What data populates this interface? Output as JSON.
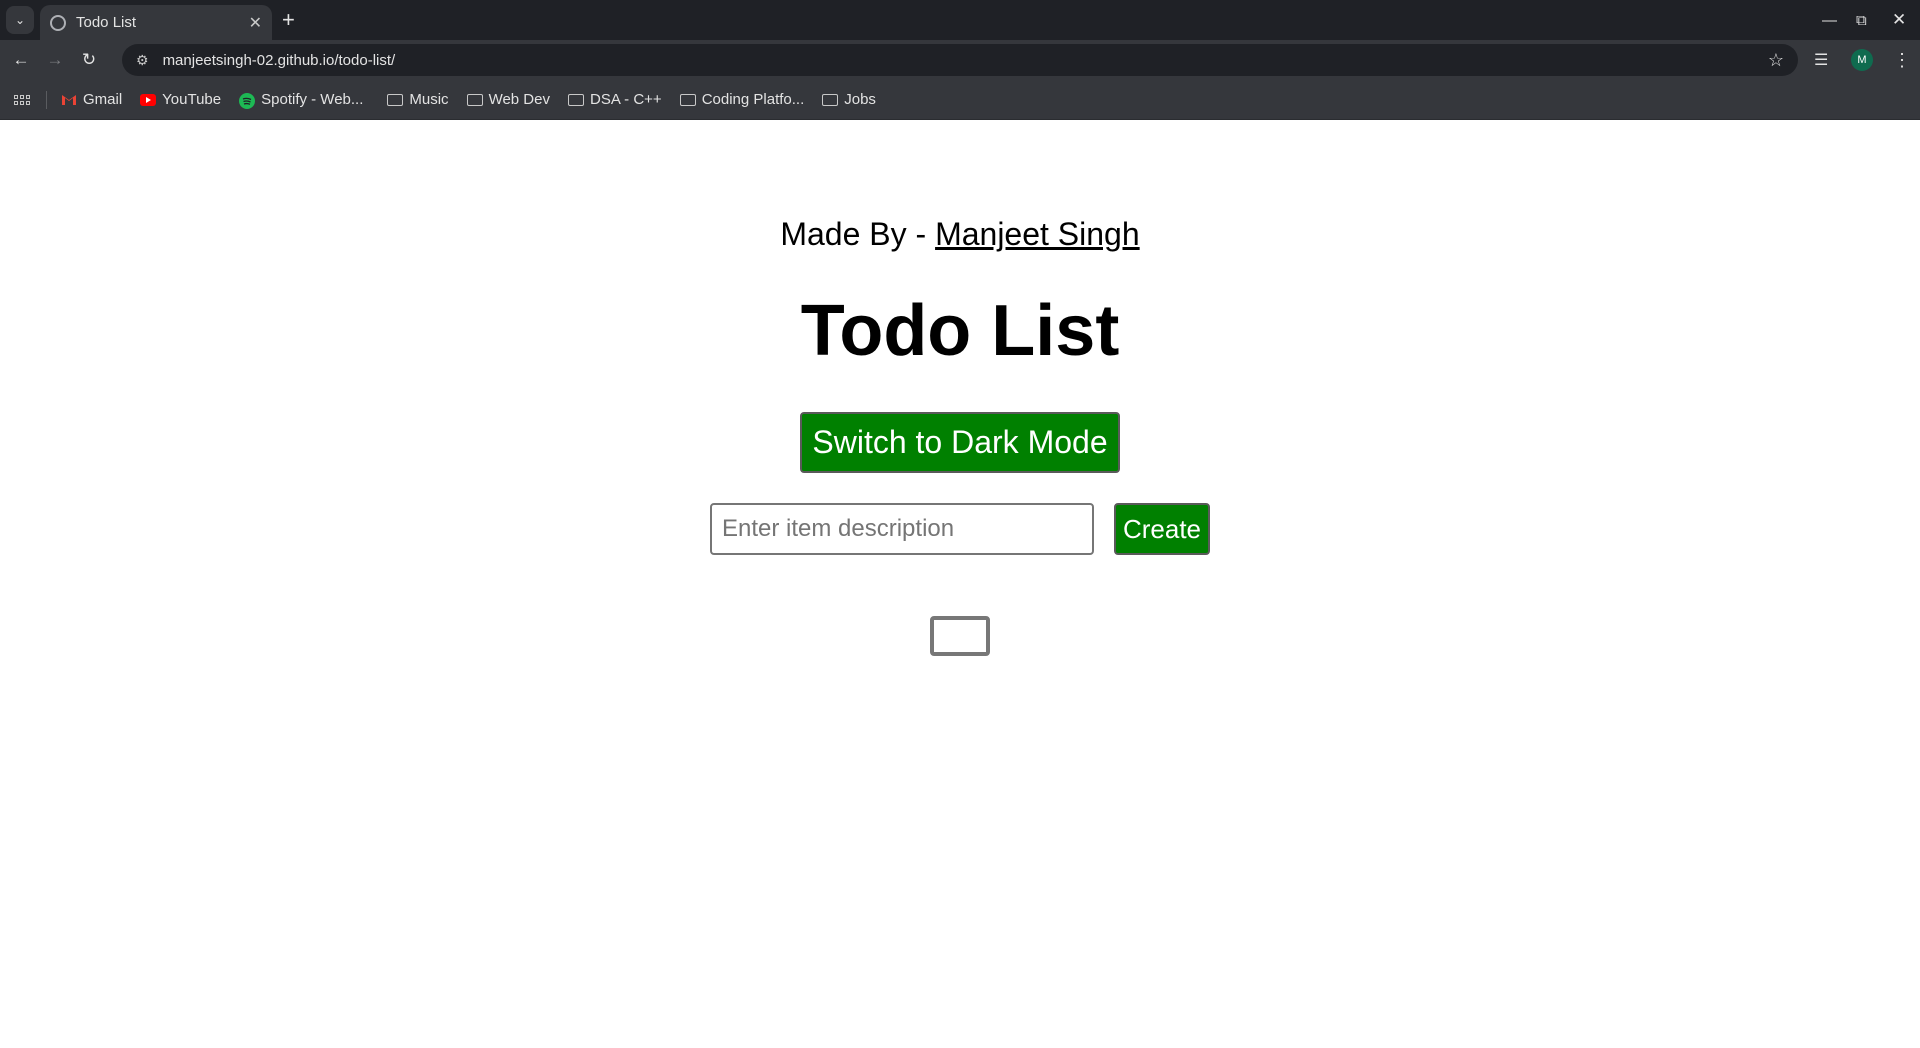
{
  "browser": {
    "tab_title": "Todo List",
    "url": "manjeetsingh-02.github.io/todo-list/",
    "profile_initial": "M",
    "bookmarks": [
      {
        "label": "Gmail",
        "type": "site",
        "icon": "gmail-icon",
        "color": "#ea4335"
      },
      {
        "label": "YouTube",
        "type": "site",
        "icon": "youtube-icon",
        "color": "#ff0000"
      },
      {
        "label": "Spotify - Web...",
        "type": "site",
        "icon": "spotify-icon",
        "color": "#1db954"
      },
      {
        "label": "Music",
        "type": "folder",
        "icon": "folder-icon"
      },
      {
        "label": "Web Dev",
        "type": "folder",
        "icon": "folder-icon"
      },
      {
        "label": "DSA - C++",
        "type": "folder",
        "icon": "folder-icon"
      },
      {
        "label": "Coding Platfo...",
        "type": "folder",
        "icon": "folder-icon"
      },
      {
        "label": "Jobs",
        "type": "folder",
        "icon": "folder-icon"
      }
    ]
  },
  "page": {
    "made_by_prefix": "Made By - ",
    "author": "Manjeet Singh",
    "title": "Todo List",
    "dark_mode_button": "Switch to Dark Mode",
    "input_placeholder": "Enter item description",
    "create_button": "Create",
    "accent_color": "#008000"
  }
}
